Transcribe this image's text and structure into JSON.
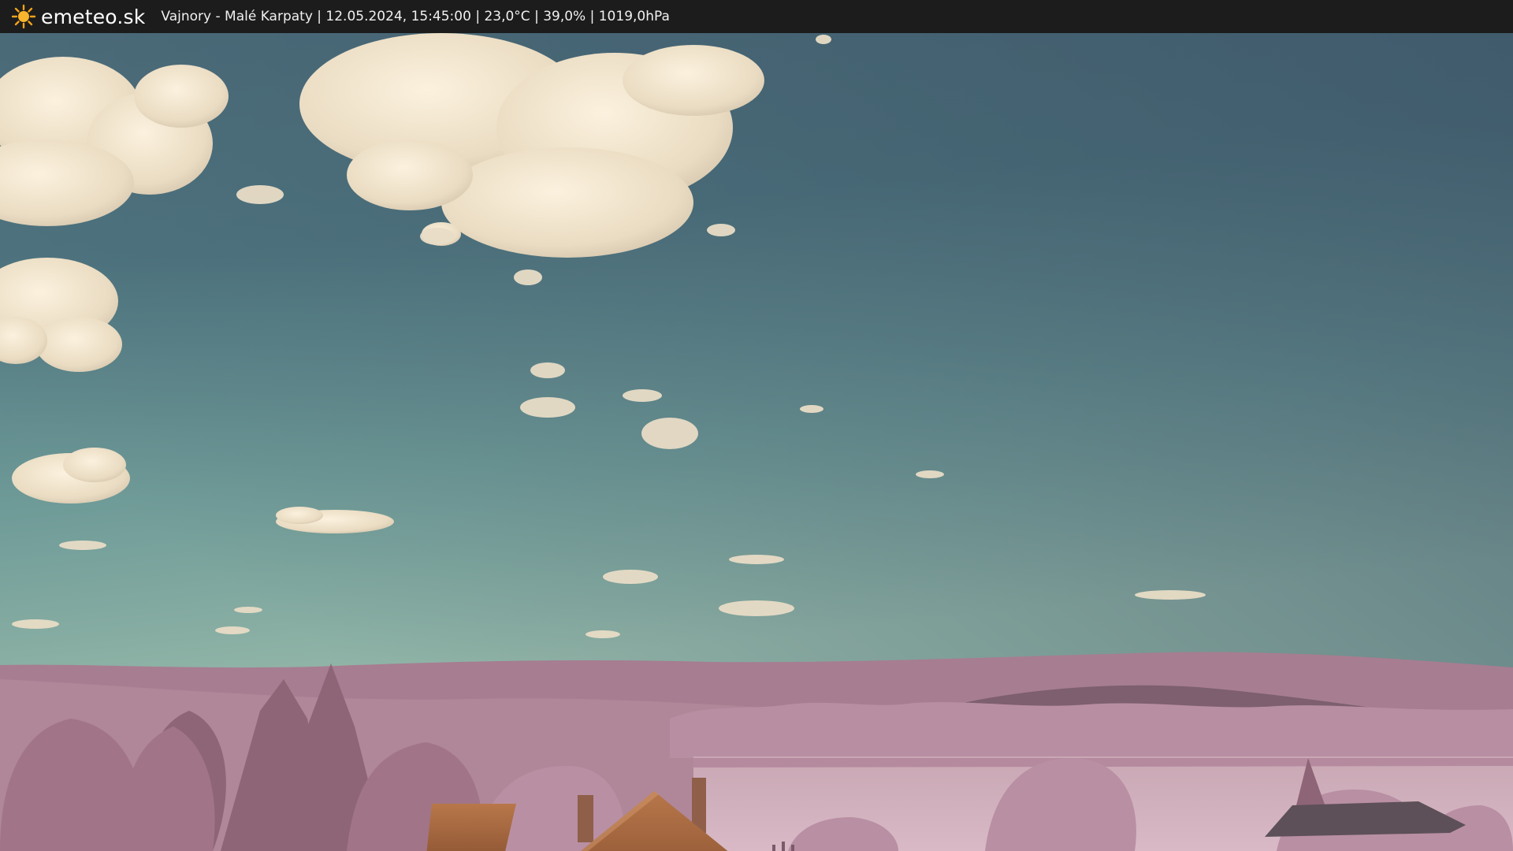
{
  "brand": {
    "name": "emeteo.sk",
    "icon": "sun-icon",
    "icon_color": "#f5a21a"
  },
  "caption": "Vajnory - Malé Karpaty | 12.05.2024, 15:45:00 | 23,0°C | 39,0% | 1019,0hPa",
  "colors": {
    "topbar": "#1c1c1c",
    "sky_top": "#3f5a6a",
    "sky_horizon": "#8ab0a6",
    "clouds": "#efe3cf",
    "hills": "#a87b92",
    "foliage": "#b48ba1",
    "roof": "#b06c3e"
  }
}
